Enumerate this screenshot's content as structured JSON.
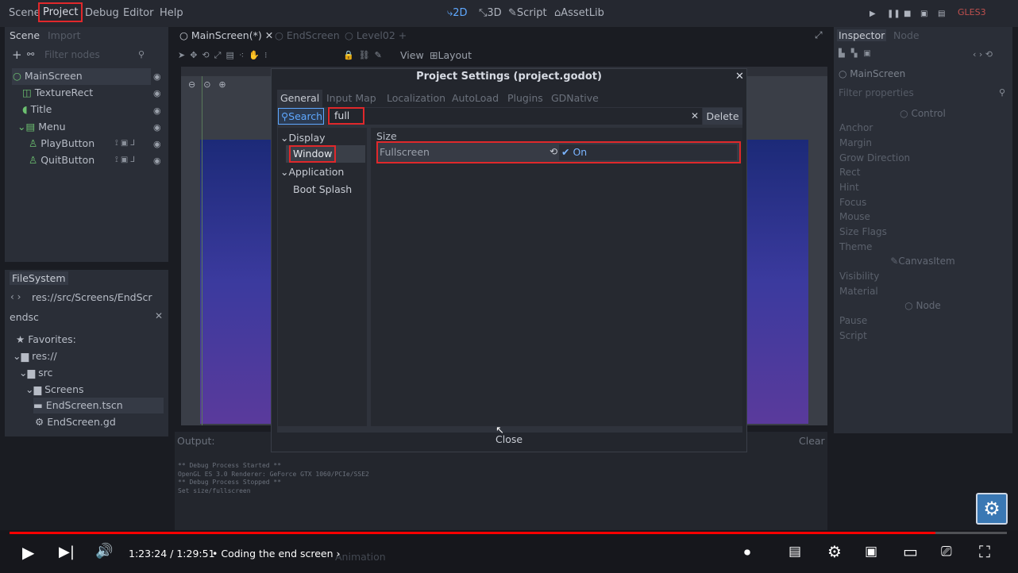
{
  "menu": {
    "items": [
      "Scene",
      "Project",
      "Debug",
      "Editor",
      "Help"
    ]
  },
  "workspaces": [
    "2D",
    "3D",
    "Script",
    "AssetLib"
  ],
  "renderer": "GLES3",
  "scene_dock": {
    "tabs": [
      "Scene",
      "Import"
    ],
    "filter_placeholder": "Filter nodes",
    "nodes": [
      "MainScreen",
      "TextureRect",
      "Title",
      "Menu",
      "PlayButton",
      "QuitButton"
    ]
  },
  "filesystem": {
    "title": "FileSystem",
    "path": "res://src/Screens/EndScr",
    "search": "endsc",
    "items": [
      "Favorites:",
      "res://",
      "src",
      "Screens",
      "EndScreen.tscn",
      "EndScreen.gd"
    ]
  },
  "editor_tabs": [
    "MainScreen(*)",
    "EndScreen",
    "Level02"
  ],
  "toolbar": {
    "view": "View",
    "layout": "Layout"
  },
  "output": {
    "title": "Output:",
    "clear": "Clear",
    "lines": [
      "** Debug Process Started **",
      "OpenGL ES 3.0 Renderer: GeForce GTX 1060/PCIe/SSE2",
      "** Debug Process Stopped **",
      "Set size/fullscreen"
    ],
    "bottom_tab": "Animation"
  },
  "inspector": {
    "tabs": [
      "Inspector",
      "Node"
    ],
    "node": "MainScreen",
    "filter_placeholder": "Filter properties",
    "control_header": "Control",
    "control_props": [
      "Anchor",
      "Margin",
      "Grow Direction",
      "Rect",
      "Hint",
      "Focus",
      "Mouse",
      "Size Flags",
      "Theme"
    ],
    "canvas_header": "CanvasItem",
    "canvas_props": [
      "Visibility",
      "Material"
    ],
    "node_header": "Node",
    "node_props": [
      "Pause",
      "Script"
    ]
  },
  "dialog": {
    "title": "Project Settings (project.godot)",
    "tabs": [
      "General",
      "Input Map",
      "Localization",
      "AutoLoad",
      "Plugins",
      "GDNative"
    ],
    "search_label": "Search",
    "search_value": "full",
    "delete_label": "Delete",
    "tree": {
      "display": "Display",
      "window": "Window",
      "application": "Application",
      "boot_splash": "Boot Splash"
    },
    "section": "Size",
    "prop_name": "Fullscreen",
    "prop_value": "On",
    "close_label": "Close"
  },
  "player": {
    "time": "1:23:24 / 1:29:51",
    "chapter": "Coding the end screen",
    "progress": 0.928
  },
  "colors": {
    "highlight": "#e0282b",
    "accent": "#5fa8ff",
    "progress": "#ff0000"
  }
}
